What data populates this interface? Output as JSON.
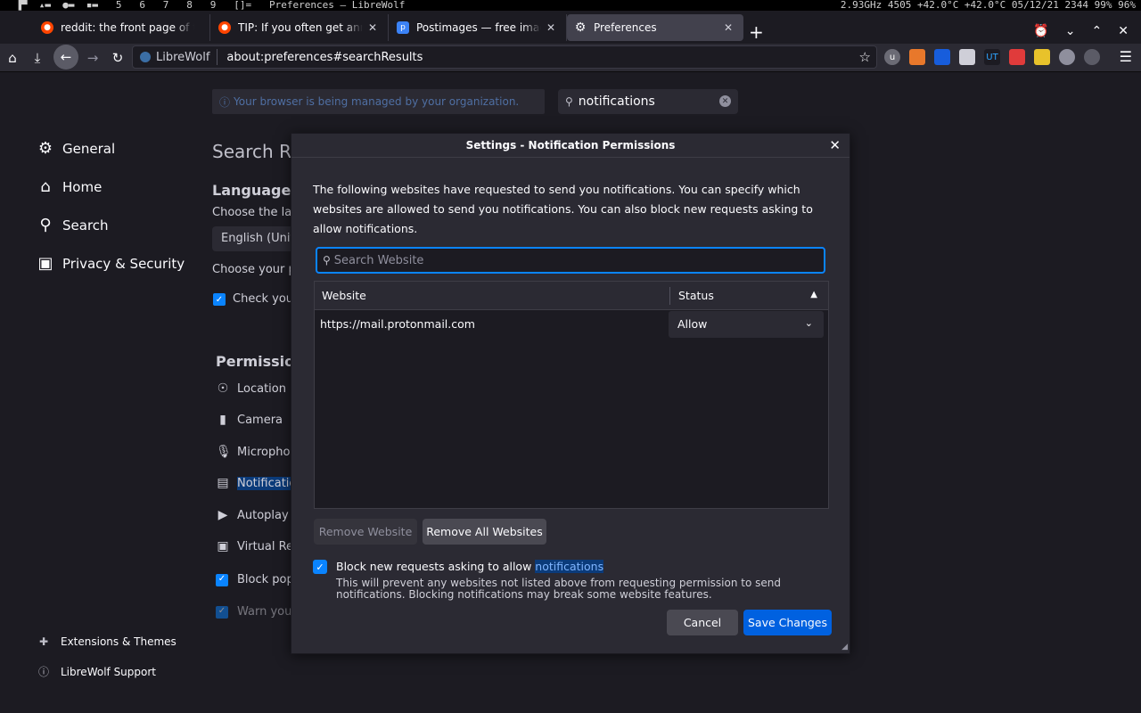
{
  "sysbar": {
    "left": "  ▐▀  ▴▬  ●▬  ▪▬   5   6   7   8   9   []=   Preferences — LibreWolf",
    "right": "2.93GHz 4505 +42.0°C +42.0°C 05/12/21 2344 99% 96%"
  },
  "tabs": [
    {
      "title": "reddit: the front page of the internet",
      "favicon": "reddit-icon"
    },
    {
      "title": "TIP: If you often get annoyed",
      "favicon": "reddit-icon"
    },
    {
      "title": "Postimages — free image hosting",
      "favicon": "postimages-icon"
    },
    {
      "title": "Preferences",
      "favicon": "gear-icon"
    }
  ],
  "navbar": {
    "identity": "LibreWolf",
    "url": "about:preferences#searchResults"
  },
  "prefs": {
    "managed_notice": "Your browser is being managed by your organization.",
    "search_value": "notifications",
    "categories": [
      {
        "label": "General",
        "icon": "gear-icon"
      },
      {
        "label": "Home",
        "icon": "home-icon"
      },
      {
        "label": "Search",
        "icon": "search-icon"
      },
      {
        "label": "Privacy & Security",
        "icon": "lock-icon"
      }
    ],
    "footer": [
      {
        "label": "Extensions & Themes",
        "icon": "puzzle-icon"
      },
      {
        "label": "LibreWolf Support",
        "icon": "help-icon"
      }
    ],
    "bg": {
      "search_results": "Search Res",
      "language": "Language",
      "choose_lang": "Choose the lan",
      "lang_select": "English (Unit",
      "choose_your": "Choose your p",
      "check_your": "Check your",
      "permissions": "Permission",
      "perms": [
        "Location",
        "Camera",
        "Microphon",
        "Notificatio",
        "Autoplay",
        "Virtual Re",
        "Block pop",
        "Warn you"
      ]
    }
  },
  "dialog": {
    "title": "Settings - Notification Permissions",
    "description": "The following websites have requested to send you notifications. You can specify which websites are allowed to send you notifications. You can also block new requests asking to allow notifications.",
    "search_placeholder": "Search Website",
    "col_website": "Website",
    "col_status": "Status",
    "rows": [
      {
        "site": "https://mail.protonmail.com",
        "status": "Allow"
      }
    ],
    "remove_website": "Remove Website",
    "remove_all": "Remove All Websites",
    "block_label": "Block new requests asking to allow ",
    "block_label_hl": "notifications",
    "block_note": "This will prevent any websites not listed above from requesting permission to send notifications. Blocking notifications may break some website features.",
    "cancel": "Cancel",
    "save": "Save Changes"
  }
}
